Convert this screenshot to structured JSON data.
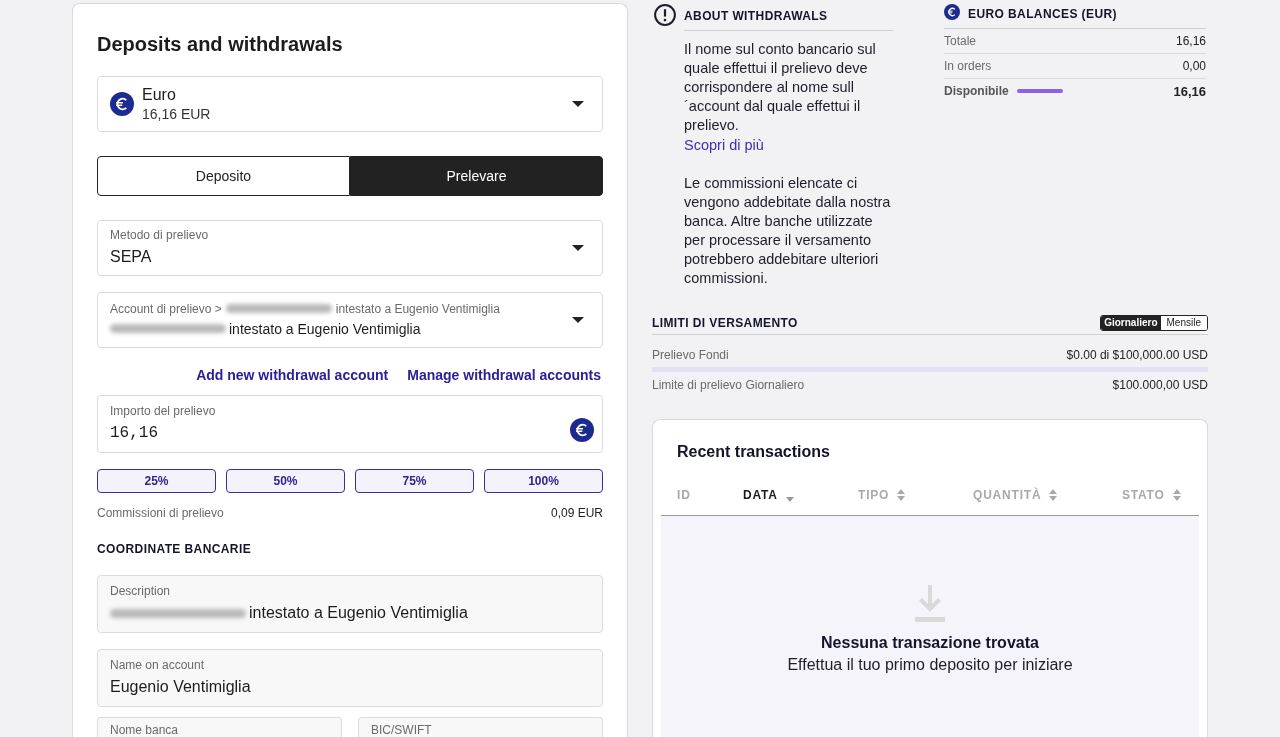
{
  "withdraw_card": {
    "title": "Deposits and withdrawals",
    "currency": {
      "name": "Euro",
      "balance": "16,16 EUR"
    },
    "tabs": [
      {
        "label": "Deposito",
        "selected": false
      },
      {
        "label": "Prelevare",
        "selected": true
      }
    ],
    "selects": [
      {
        "kind": "method",
        "label": "Metodo di prelievo",
        "value": "SEPA",
        "redacted": false
      },
      {
        "kind": "account",
        "label": "Account di prelievo >",
        "label_tail": "intestato a Eugenio Ventimiglia",
        "value": "intestato a Eugenio Ventimiglia",
        "redacted": true
      }
    ],
    "links": [
      "Add new withdrawal account",
      "Manage withdrawal accounts"
    ],
    "amount": {
      "label": "Importo del prelievo",
      "value": "16,16"
    },
    "percent_buttons": [
      "25%",
      "50%",
      "75%",
      "100%"
    ],
    "fee": {
      "label": "Commissioni di prelievo",
      "value": "0,09 EUR"
    },
    "bank_details": {
      "title": "COORDINATE BANCARIE",
      "fields": [
        {
          "kind": "wide",
          "label": "Description",
          "value": "intestato a Eugenio Ventimiglia",
          "redacted": true
        },
        {
          "kind": "wide",
          "label": "Name on account",
          "value": "Eugenio Ventimiglia",
          "redacted": false
        },
        {
          "kind": "half",
          "label": "Nome banca"
        },
        {
          "kind": "half",
          "label": "BIC/SWIFT"
        }
      ]
    }
  },
  "about": {
    "title": "ABOUT WITHDRAWALS",
    "blocks": [
      {
        "kind": "text",
        "text": "Il nome sul conto bancario sul quale effettui il prelievo deve corrispondere al nome sull´account dal quale effettui il prelievo."
      },
      {
        "kind": "link",
        "text": "Scopri di più"
      },
      {
        "kind": "text",
        "text": "Le commissioni elencate ci vengono addebitate dalla nostra banca. Altre banche utilizzate per processare il versamento potrebbero addebitare ulteriori commissioni."
      }
    ]
  },
  "balances": {
    "title": "EURO BALANCES (EUR)",
    "rows": [
      {
        "kind": "plain",
        "label": "Totale",
        "value": "16,16"
      },
      {
        "kind": "plain",
        "label": "In orders",
        "value": "0,00"
      },
      {
        "kind": "available",
        "label": "Disponibile",
        "value": "16,16",
        "level": 1
      }
    ]
  },
  "limits": {
    "title": "LIMITI DI VERSAMENTO",
    "periods": [
      {
        "label": "Giornaliero",
        "selected": true
      },
      {
        "label": "Mensile",
        "selected": false
      }
    ],
    "rows": [
      {
        "label": "Prelievo Fondi",
        "value": "$0.00 di $100,000.00 USD",
        "level": 0
      },
      {
        "label": "Limite di prelievo Giornaliero",
        "value": "$100.000,00 USD"
      }
    ]
  },
  "transactions": {
    "title": "Recent transactions",
    "columns": [
      {
        "label": "ID",
        "sortable": false,
        "sorted": false
      },
      {
        "label": "DATA",
        "sortable": true,
        "sorted": true
      },
      {
        "label": "TIPO",
        "sortable": true,
        "sorted": false
      },
      {
        "label": "QUANTITÀ",
        "sortable": true,
        "sorted": false
      },
      {
        "label": "STATO",
        "sortable": true,
        "sorted": false
      }
    ],
    "empty_title": "Nessuna transazione trovata",
    "empty_text": "Effettua il tuo primo deposito per iniziare"
  }
}
